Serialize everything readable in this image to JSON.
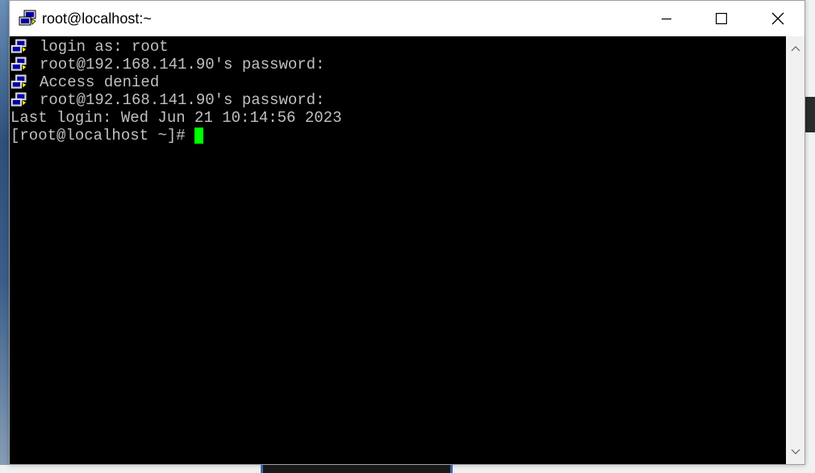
{
  "window": {
    "title": "root@localhost:~"
  },
  "terminal": {
    "lines": [
      {
        "icon": "putty-icon",
        "text": "login as: root"
      },
      {
        "icon": "putty-icon",
        "text": "root@192.168.141.90's password:"
      },
      {
        "icon": "putty-icon",
        "text": "Access denied"
      },
      {
        "icon": "putty-icon",
        "text": "root@192.168.141.90's password:"
      },
      {
        "icon": null,
        "text": "Last login: Wed Jun 21 10:14:56 2023"
      },
      {
        "icon": null,
        "text": "[root@localhost ~]# "
      }
    ],
    "colors": {
      "background": "#000000",
      "foreground": "#c0c0c0",
      "cursor": "#00ff00"
    }
  },
  "icons": {
    "app": "putty-icon",
    "minimize": "minimize-icon",
    "maximize": "maximize-icon",
    "close": "close-icon",
    "scroll_up": "chevron-up-icon",
    "scroll_down": "chevron-down-icon"
  }
}
